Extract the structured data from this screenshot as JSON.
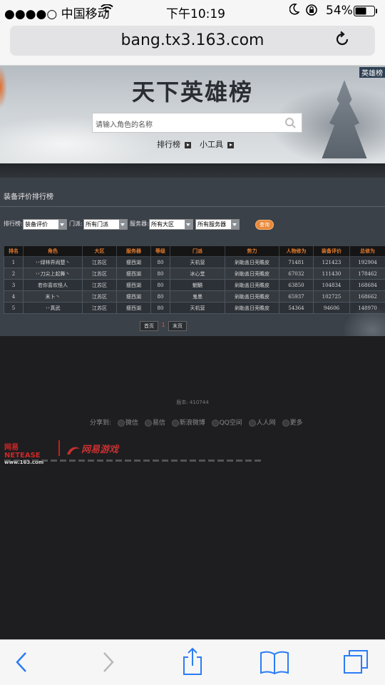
{
  "status_bar": {
    "carrier": "●●●●○ 中国移动",
    "time": "下午10:19",
    "battery": "54%"
  },
  "browser": {
    "url": "bang.tx3.163.com"
  },
  "banner": {
    "title": "天下英雄榜",
    "corner_tab": "英雄榜",
    "search_placeholder": "请输入角色的名称",
    "nav": [
      "排行榜",
      "小工具"
    ]
  },
  "panel": {
    "title": "装备评价排行榜",
    "filters": {
      "ranking_label": "排行榜:",
      "ranking_value": "装备评价",
      "school_label": "门派:",
      "school_value": "所有门派",
      "server_label": "服务器:",
      "region_value": "所有大区",
      "server_value": "所有服务器",
      "query_button": "查询"
    },
    "columns": [
      "排名",
      "角色",
      "大区",
      "服务器",
      "等级",
      "门派",
      "势力",
      "人物修为",
      "装备评价",
      "总修为"
    ],
    "rows": [
      [
        "1",
        "丷绿林界闹楚丶",
        "江苏区",
        "瘦西湖",
        "80",
        "天机营",
        "剁勒盖日壳瞻皮",
        "71481",
        "121423",
        "192904"
      ],
      [
        "2",
        "丷刀尖上起舞丶",
        "江苏区",
        "瘦西湖",
        "80",
        "冰心堂",
        "剁勒盖日壳瞻皮",
        "67032",
        "111430",
        "178462"
      ],
      [
        "3",
        "若你喜欢怪人",
        "江苏区",
        "瘦西湖",
        "80",
        "魍魉",
        "剁勒盖日壳瞻皮",
        "63850",
        "104834",
        "168684"
      ],
      [
        "4",
        "末卜丶",
        "江苏区",
        "瘦西湖",
        "80",
        "鬼墨",
        "剁勒盖日壳瞻皮",
        "65937",
        "102725",
        "168662"
      ],
      [
        "5",
        "丷真武",
        "江苏区",
        "瘦西湖",
        "80",
        "天机营",
        "剁勒盖日壳瞻皮",
        "54364",
        "94606",
        "148970"
      ]
    ],
    "pager": {
      "first": "首页",
      "current": "1",
      "last": "末页"
    }
  },
  "footer": {
    "version": "版本: 410744",
    "share_label": "分享到:",
    "share_items": [
      "微信",
      "易信",
      "新浪微博",
      "QQ空间",
      "人人网",
      "更多"
    ],
    "netease_logo_top": "网易 NETEASE",
    "netease_logo_bottom": "www.163.com",
    "game_logo": "网易游戏"
  },
  "colors": {
    "table_header_text": "#e07a2e",
    "query_button": "#e8883a",
    "panel_bg": "#3b4148"
  }
}
